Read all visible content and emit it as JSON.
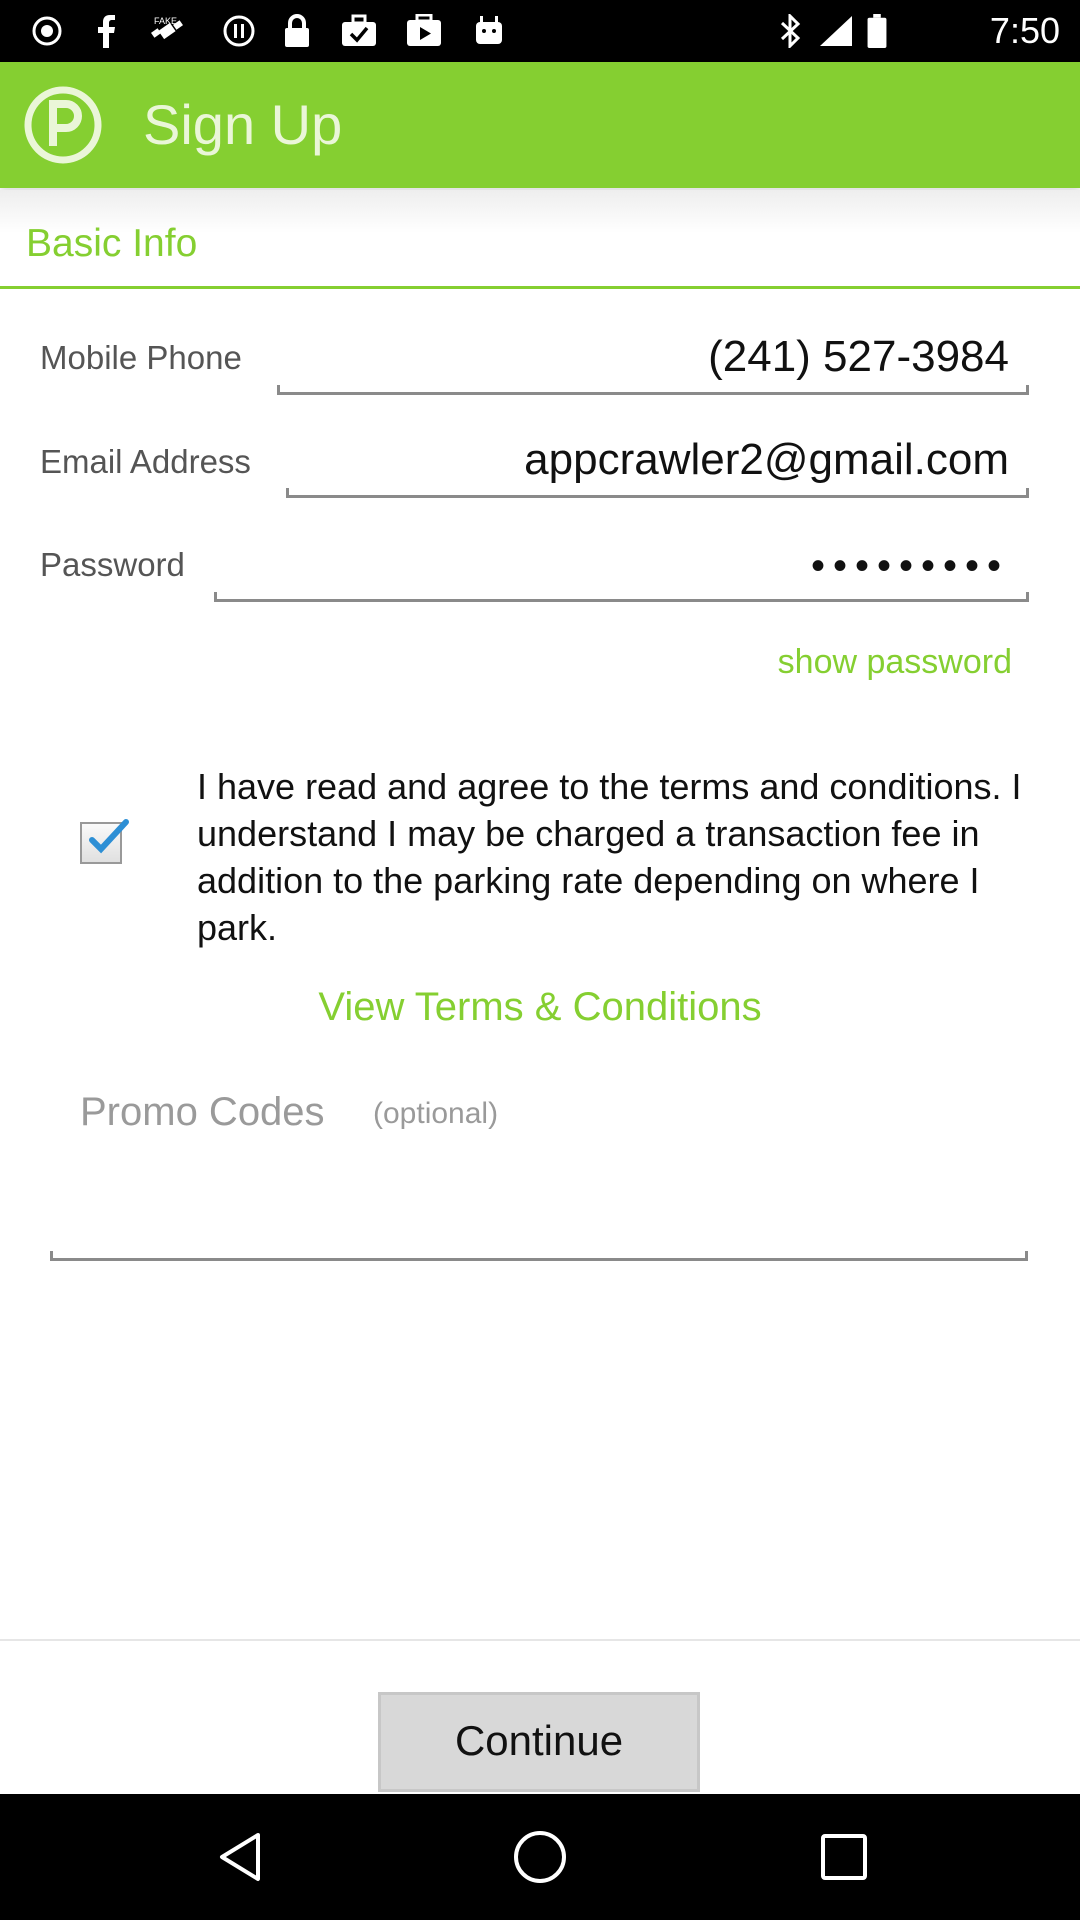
{
  "status_bar": {
    "time": "7:50",
    "icons": [
      "record-icon",
      "facebook-icon",
      "fake-gps-icon",
      "sync-icon",
      "lock-icon",
      "briefcase-check-icon",
      "play-store-icon",
      "android-icon",
      "bluetooth-icon",
      "signal-icon",
      "battery-icon"
    ]
  },
  "header": {
    "title": "Sign Up",
    "logo_icon": "parking-p-logo-icon"
  },
  "section": {
    "title": "Basic Info"
  },
  "form": {
    "mobile_phone": {
      "label": "Mobile Phone",
      "value": "(241) 527-3984"
    },
    "email": {
      "label": "Email Address",
      "value": "appcrawler2@gmail.com"
    },
    "password": {
      "label": "Password",
      "value": "•••••••••"
    },
    "show_password": "show password"
  },
  "terms": {
    "checked": true,
    "text": "I have read and agree to the terms and conditions. I understand I may be charged a transaction fee in addition to the parking rate depending on where I park.",
    "link": "View Terms & Conditions"
  },
  "promo": {
    "label": "Promo Codes",
    "optional": "(optional)",
    "value": ""
  },
  "actions": {
    "continue": "Continue"
  },
  "nav_bar": {
    "icons": [
      "back-icon",
      "home-icon",
      "recents-icon"
    ]
  },
  "colors": {
    "accent": "#85cf31",
    "header_bg": "#85cf31",
    "button_bg": "#d8d8d8"
  }
}
